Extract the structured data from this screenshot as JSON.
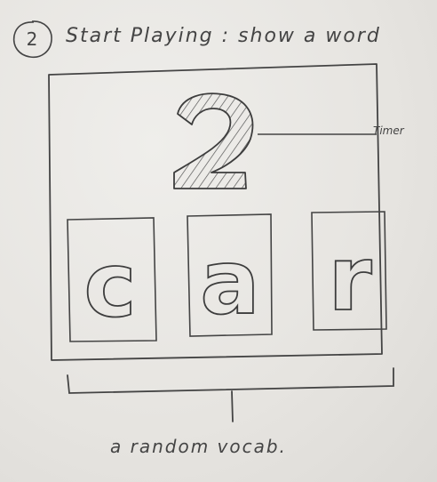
{
  "step": {
    "number": "2",
    "title": "Start Playing : show a word"
  },
  "timer": {
    "value": "2",
    "label": "Timer"
  },
  "word": {
    "letters": [
      "c",
      "a",
      "r"
    ]
  },
  "caption": "a random vocab."
}
